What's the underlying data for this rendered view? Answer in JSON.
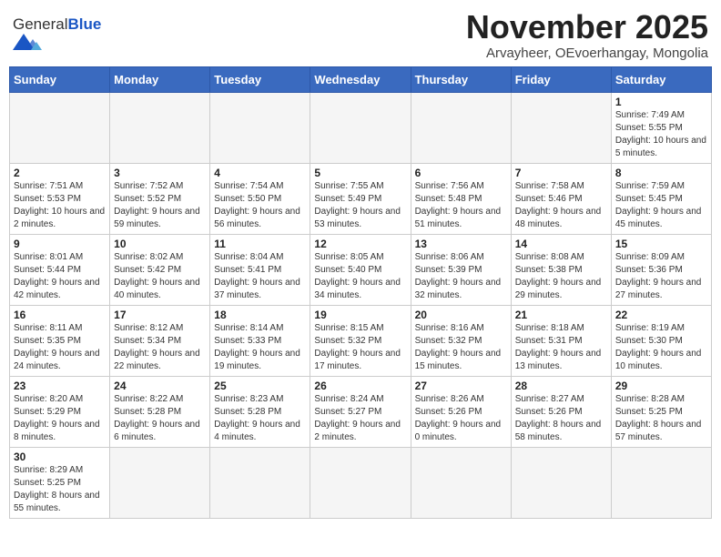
{
  "header": {
    "logo_general": "General",
    "logo_blue": "Blue",
    "month_title": "November 2025",
    "subtitle": "Arvayheer, OEvoerhangay, Mongolia"
  },
  "weekdays": [
    "Sunday",
    "Monday",
    "Tuesday",
    "Wednesday",
    "Thursday",
    "Friday",
    "Saturday"
  ],
  "weeks": [
    [
      {
        "day": "",
        "info": ""
      },
      {
        "day": "",
        "info": ""
      },
      {
        "day": "",
        "info": ""
      },
      {
        "day": "",
        "info": ""
      },
      {
        "day": "",
        "info": ""
      },
      {
        "day": "",
        "info": ""
      },
      {
        "day": "1",
        "info": "Sunrise: 7:49 AM\nSunset: 5:55 PM\nDaylight: 10 hours and 5 minutes."
      }
    ],
    [
      {
        "day": "2",
        "info": "Sunrise: 7:51 AM\nSunset: 5:53 PM\nDaylight: 10 hours and 2 minutes."
      },
      {
        "day": "3",
        "info": "Sunrise: 7:52 AM\nSunset: 5:52 PM\nDaylight: 9 hours and 59 minutes."
      },
      {
        "day": "4",
        "info": "Sunrise: 7:54 AM\nSunset: 5:50 PM\nDaylight: 9 hours and 56 minutes."
      },
      {
        "day": "5",
        "info": "Sunrise: 7:55 AM\nSunset: 5:49 PM\nDaylight: 9 hours and 53 minutes."
      },
      {
        "day": "6",
        "info": "Sunrise: 7:56 AM\nSunset: 5:48 PM\nDaylight: 9 hours and 51 minutes."
      },
      {
        "day": "7",
        "info": "Sunrise: 7:58 AM\nSunset: 5:46 PM\nDaylight: 9 hours and 48 minutes."
      },
      {
        "day": "8",
        "info": "Sunrise: 7:59 AM\nSunset: 5:45 PM\nDaylight: 9 hours and 45 minutes."
      }
    ],
    [
      {
        "day": "9",
        "info": "Sunrise: 8:01 AM\nSunset: 5:44 PM\nDaylight: 9 hours and 42 minutes."
      },
      {
        "day": "10",
        "info": "Sunrise: 8:02 AM\nSunset: 5:42 PM\nDaylight: 9 hours and 40 minutes."
      },
      {
        "day": "11",
        "info": "Sunrise: 8:04 AM\nSunset: 5:41 PM\nDaylight: 9 hours and 37 minutes."
      },
      {
        "day": "12",
        "info": "Sunrise: 8:05 AM\nSunset: 5:40 PM\nDaylight: 9 hours and 34 minutes."
      },
      {
        "day": "13",
        "info": "Sunrise: 8:06 AM\nSunset: 5:39 PM\nDaylight: 9 hours and 32 minutes."
      },
      {
        "day": "14",
        "info": "Sunrise: 8:08 AM\nSunset: 5:38 PM\nDaylight: 9 hours and 29 minutes."
      },
      {
        "day": "15",
        "info": "Sunrise: 8:09 AM\nSunset: 5:36 PM\nDaylight: 9 hours and 27 minutes."
      }
    ],
    [
      {
        "day": "16",
        "info": "Sunrise: 8:11 AM\nSunset: 5:35 PM\nDaylight: 9 hours and 24 minutes."
      },
      {
        "day": "17",
        "info": "Sunrise: 8:12 AM\nSunset: 5:34 PM\nDaylight: 9 hours and 22 minutes."
      },
      {
        "day": "18",
        "info": "Sunrise: 8:14 AM\nSunset: 5:33 PM\nDaylight: 9 hours and 19 minutes."
      },
      {
        "day": "19",
        "info": "Sunrise: 8:15 AM\nSunset: 5:32 PM\nDaylight: 9 hours and 17 minutes."
      },
      {
        "day": "20",
        "info": "Sunrise: 8:16 AM\nSunset: 5:32 PM\nDaylight: 9 hours and 15 minutes."
      },
      {
        "day": "21",
        "info": "Sunrise: 8:18 AM\nSunset: 5:31 PM\nDaylight: 9 hours and 13 minutes."
      },
      {
        "day": "22",
        "info": "Sunrise: 8:19 AM\nSunset: 5:30 PM\nDaylight: 9 hours and 10 minutes."
      }
    ],
    [
      {
        "day": "23",
        "info": "Sunrise: 8:20 AM\nSunset: 5:29 PM\nDaylight: 9 hours and 8 minutes."
      },
      {
        "day": "24",
        "info": "Sunrise: 8:22 AM\nSunset: 5:28 PM\nDaylight: 9 hours and 6 minutes."
      },
      {
        "day": "25",
        "info": "Sunrise: 8:23 AM\nSunset: 5:28 PM\nDaylight: 9 hours and 4 minutes."
      },
      {
        "day": "26",
        "info": "Sunrise: 8:24 AM\nSunset: 5:27 PM\nDaylight: 9 hours and 2 minutes."
      },
      {
        "day": "27",
        "info": "Sunrise: 8:26 AM\nSunset: 5:26 PM\nDaylight: 9 hours and 0 minutes."
      },
      {
        "day": "28",
        "info": "Sunrise: 8:27 AM\nSunset: 5:26 PM\nDaylight: 8 hours and 58 minutes."
      },
      {
        "day": "29",
        "info": "Sunrise: 8:28 AM\nSunset: 5:25 PM\nDaylight: 8 hours and 57 minutes."
      }
    ],
    [
      {
        "day": "30",
        "info": "Sunrise: 8:29 AM\nSunset: 5:25 PM\nDaylight: 8 hours and 55 minutes."
      },
      {
        "day": "",
        "info": ""
      },
      {
        "day": "",
        "info": ""
      },
      {
        "day": "",
        "info": ""
      },
      {
        "day": "",
        "info": ""
      },
      {
        "day": "",
        "info": ""
      },
      {
        "day": "",
        "info": ""
      }
    ]
  ]
}
